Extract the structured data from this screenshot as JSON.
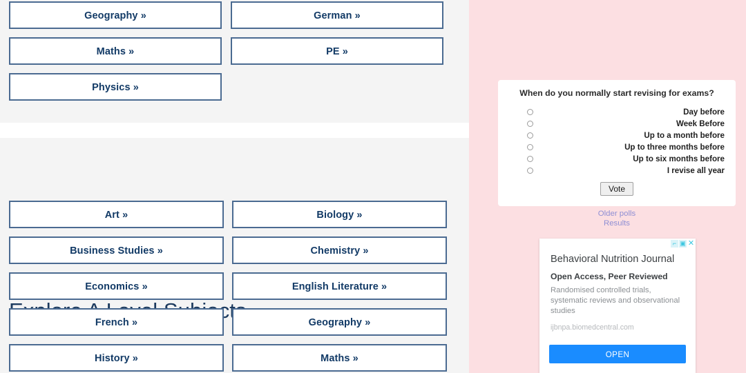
{
  "left": {
    "top_grid": {
      "left_column": [
        {
          "label": "Geography »"
        },
        {
          "label": "Maths »"
        },
        {
          "label": "Physics »"
        }
      ],
      "right_column": [
        {
          "label": "German »"
        },
        {
          "label": "PE »"
        }
      ]
    },
    "heading": "Explore A Level Subjects",
    "bottom_grid": {
      "left_column": [
        {
          "label": "Art »"
        },
        {
          "label": "Business Studies »"
        },
        {
          "label": "Economics »"
        },
        {
          "label": "French »"
        },
        {
          "label": "History »"
        }
      ],
      "right_column": [
        {
          "label": "Biology »"
        },
        {
          "label": "Chemistry »"
        },
        {
          "label": "English Literature »"
        },
        {
          "label": "Geography »"
        },
        {
          "label": "Maths »"
        }
      ]
    }
  },
  "sidebar": {
    "poll": {
      "question": "When do you normally start revising for exams?",
      "options": [
        "Day before",
        "Week Before",
        "Up to a month before",
        "Up to three months before",
        "Up to six months before",
        "I revise all year"
      ],
      "vote_label": "Vote",
      "links": [
        "Older polls",
        "Results"
      ]
    },
    "ad": {
      "controls": [
        {
          "icon": "resize-corner-icon",
          "glyph": "⌐"
        },
        {
          "icon": "adchoices-icon",
          "glyph": "▣"
        },
        {
          "icon": "close-icon",
          "glyph": "✕"
        }
      ],
      "title": "Behavioral Nutrition Journal",
      "subtitle": "Open Access, Peer Reviewed",
      "body": "Randomised controlled trials, systematic reviews and observational studies",
      "url": "ijbnpa.biomedcentral.com",
      "cta_label": "OPEN"
    }
  },
  "colors": {
    "button_border": "#4a6a91",
    "button_text": "#123a66",
    "heading": "#1c3a5e",
    "section_bg": "#f4f4f4",
    "sidebar_bg": "#fcdfe2",
    "link": "#8f8fd4",
    "cta": "#1a8cff"
  }
}
